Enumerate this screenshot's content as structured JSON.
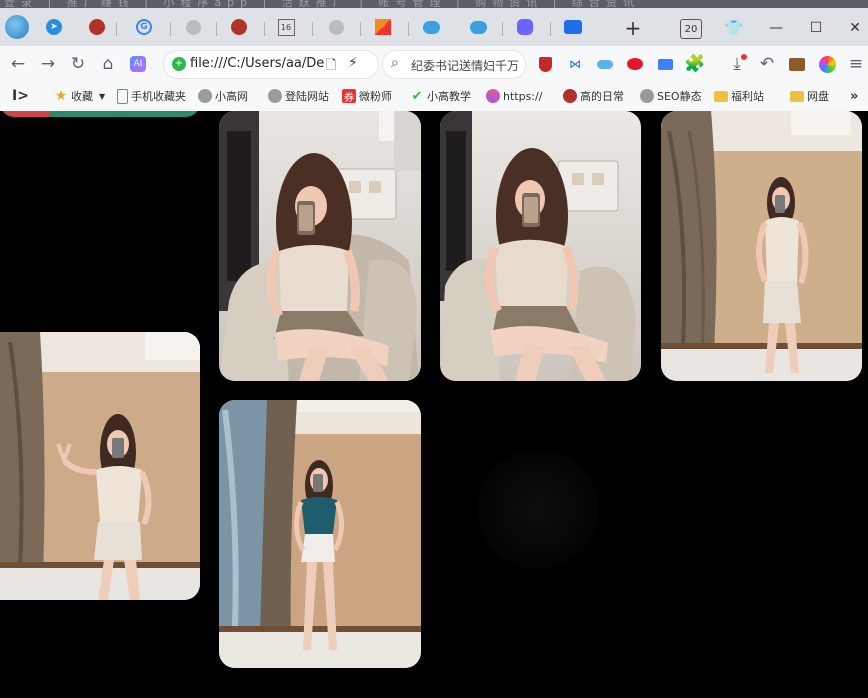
{
  "top_strip_text": "登录 | 推广赚钱 | 小程序app | 活跃推广 | 帐号管理 | 购物资讯 | 综合资讯",
  "tabs": [
    {
      "icon": "app-avatar-icon",
      "color": "#4a9fd8"
    },
    {
      "icon": "telegram-icon",
      "color": "#2a8de0"
    },
    {
      "icon": "red-mask-icon",
      "color": "#b0302a"
    },
    {
      "icon": "g-circle-icon",
      "color": "#3b82f6"
    },
    {
      "icon": "globe-icon",
      "color": "#999"
    },
    {
      "icon": "red-mask-icon",
      "color": "#b0302a"
    },
    {
      "icon": "calendar-icon",
      "color": "#666",
      "text": "16"
    },
    {
      "icon": "globe-icon",
      "color": "#999"
    },
    {
      "icon": "orange-flag-icon",
      "color": "#f08c1e"
    },
    {
      "icon": "cloud-app-icon",
      "color": "#3aa0e0"
    },
    {
      "icon": "cloud-app-icon",
      "color": "#3aa0e0"
    },
    {
      "icon": "q-circle-icon",
      "color": "#6c63ff"
    },
    {
      "icon": "blue-app-icon",
      "color": "#1e6fe8"
    }
  ],
  "window": {
    "tab_count": "20",
    "new_tab": "+",
    "minimize": "—",
    "maximize": "☐",
    "close": "✕"
  },
  "nav": {
    "url": "file:///C:/Users/aa/De",
    "search_placeholder": "纪委书记送情妇千万"
  },
  "bookmarks": [
    {
      "label": "收藏",
      "icon": "star-icon",
      "color": "#f5a623"
    },
    {
      "label": "手机收藏夹",
      "icon": "phone-icon",
      "color": "#2db84b"
    },
    {
      "label": "小高网",
      "icon": "globe-icon",
      "color": "#777"
    },
    {
      "label": "登陆网站",
      "icon": "globe-icon",
      "color": "#777"
    },
    {
      "label": "微粉师",
      "icon": "red-square-icon",
      "color": "#e33"
    },
    {
      "label": "小高教学",
      "icon": "check-icon",
      "color": "#2db84b"
    },
    {
      "label": "https://",
      "icon": "pinwheel-icon",
      "color": "#e05aa0"
    },
    {
      "label": "高的日常",
      "icon": "red-mask-icon",
      "color": "#b0302a"
    },
    {
      "label": "SEO静态",
      "icon": "globe-icon",
      "color": "#777"
    },
    {
      "label": "福利站",
      "icon": "folder-icon",
      "color": "#f0c040"
    },
    {
      "label": "网盘",
      "icon": "folder-icon",
      "color": "#f0c040"
    }
  ],
  "colors": {
    "tab_bg": "#dee1e6",
    "toolbar_bg": "#f7f8fa",
    "page_bg": "#000000"
  }
}
